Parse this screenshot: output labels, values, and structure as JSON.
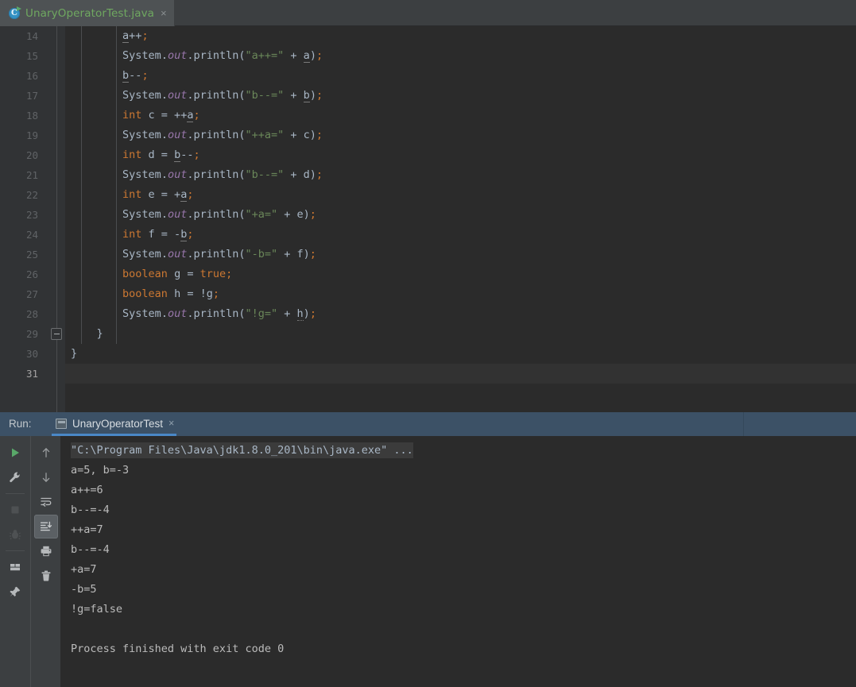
{
  "editor": {
    "tab": {
      "filename": "UnaryOperatorTest.java",
      "icon": "java-class-runnable-icon",
      "icon_letter": "C",
      "close_label": "×",
      "label_color": "#6fa860"
    },
    "first_line_number": 14,
    "current_line_number": 31,
    "lines": [
      {
        "n": 14,
        "tokens": [
          {
            "t": "        ",
            "c": "plain"
          },
          {
            "t": "a",
            "c": "var"
          },
          {
            "t": "++",
            "c": "plain"
          },
          {
            "t": ";",
            "c": "semi"
          }
        ]
      },
      {
        "n": 15,
        "tokens": [
          {
            "t": "        ",
            "c": "plain"
          },
          {
            "t": "System",
            "c": "plain"
          },
          {
            "t": ".",
            "c": "plain"
          },
          {
            "t": "out",
            "c": "field"
          },
          {
            "t": ".println(",
            "c": "plain"
          },
          {
            "t": "\"a++=\"",
            "c": "str"
          },
          {
            "t": " + ",
            "c": "plain"
          },
          {
            "t": "a",
            "c": "var"
          },
          {
            "t": ")",
            "c": "plain"
          },
          {
            "t": ";",
            "c": "semi"
          }
        ]
      },
      {
        "n": 16,
        "tokens": [
          {
            "t": "        ",
            "c": "plain"
          },
          {
            "t": "b",
            "c": "var"
          },
          {
            "t": "--",
            "c": "plain"
          },
          {
            "t": ";",
            "c": "semi"
          }
        ]
      },
      {
        "n": 17,
        "tokens": [
          {
            "t": "        ",
            "c": "plain"
          },
          {
            "t": "System",
            "c": "plain"
          },
          {
            "t": ".",
            "c": "plain"
          },
          {
            "t": "out",
            "c": "field"
          },
          {
            "t": ".println(",
            "c": "plain"
          },
          {
            "t": "\"b--=\"",
            "c": "str"
          },
          {
            "t": " + ",
            "c": "plain"
          },
          {
            "t": "b",
            "c": "var"
          },
          {
            "t": ")",
            "c": "plain"
          },
          {
            "t": ";",
            "c": "semi"
          }
        ]
      },
      {
        "n": 18,
        "tokens": [
          {
            "t": "        ",
            "c": "plain"
          },
          {
            "t": "int",
            "c": "kw"
          },
          {
            "t": " c = ++",
            "c": "plain"
          },
          {
            "t": "a",
            "c": "var"
          },
          {
            "t": ";",
            "c": "semi"
          }
        ]
      },
      {
        "n": 19,
        "tokens": [
          {
            "t": "        ",
            "c": "plain"
          },
          {
            "t": "System",
            "c": "plain"
          },
          {
            "t": ".",
            "c": "plain"
          },
          {
            "t": "out",
            "c": "field"
          },
          {
            "t": ".println(",
            "c": "plain"
          },
          {
            "t": "\"++a=\"",
            "c": "str"
          },
          {
            "t": " + c)",
            "c": "plain"
          },
          {
            "t": ";",
            "c": "semi"
          }
        ]
      },
      {
        "n": 20,
        "tokens": [
          {
            "t": "        ",
            "c": "plain"
          },
          {
            "t": "int",
            "c": "kw"
          },
          {
            "t": " d = ",
            "c": "plain"
          },
          {
            "t": "b",
            "c": "var"
          },
          {
            "t": "--",
            "c": "plain"
          },
          {
            "t": ";",
            "c": "semi"
          }
        ]
      },
      {
        "n": 21,
        "tokens": [
          {
            "t": "        ",
            "c": "plain"
          },
          {
            "t": "System",
            "c": "plain"
          },
          {
            "t": ".",
            "c": "plain"
          },
          {
            "t": "out",
            "c": "field"
          },
          {
            "t": ".println(",
            "c": "plain"
          },
          {
            "t": "\"b--=\"",
            "c": "str"
          },
          {
            "t": " + d)",
            "c": "plain"
          },
          {
            "t": ";",
            "c": "semi"
          }
        ]
      },
      {
        "n": 22,
        "tokens": [
          {
            "t": "        ",
            "c": "plain"
          },
          {
            "t": "int",
            "c": "kw"
          },
          {
            "t": " e = +",
            "c": "plain"
          },
          {
            "t": "a",
            "c": "var"
          },
          {
            "t": ";",
            "c": "semi"
          }
        ]
      },
      {
        "n": 23,
        "tokens": [
          {
            "t": "        ",
            "c": "plain"
          },
          {
            "t": "System",
            "c": "plain"
          },
          {
            "t": ".",
            "c": "plain"
          },
          {
            "t": "out",
            "c": "field"
          },
          {
            "t": ".println(",
            "c": "plain"
          },
          {
            "t": "\"+a=\"",
            "c": "str"
          },
          {
            "t": " + e)",
            "c": "plain"
          },
          {
            "t": ";",
            "c": "semi"
          }
        ]
      },
      {
        "n": 24,
        "tokens": [
          {
            "t": "        ",
            "c": "plain"
          },
          {
            "t": "int",
            "c": "kw"
          },
          {
            "t": " f = -",
            "c": "plain"
          },
          {
            "t": "b",
            "c": "var"
          },
          {
            "t": ";",
            "c": "semi"
          }
        ]
      },
      {
        "n": 25,
        "tokens": [
          {
            "t": "        ",
            "c": "plain"
          },
          {
            "t": "System",
            "c": "plain"
          },
          {
            "t": ".",
            "c": "plain"
          },
          {
            "t": "out",
            "c": "field"
          },
          {
            "t": ".println(",
            "c": "plain"
          },
          {
            "t": "\"-b=\"",
            "c": "str"
          },
          {
            "t": " + f)",
            "c": "plain"
          },
          {
            "t": ";",
            "c": "semi"
          }
        ]
      },
      {
        "n": 26,
        "tokens": [
          {
            "t": "        ",
            "c": "plain"
          },
          {
            "t": "boolean",
            "c": "kw"
          },
          {
            "t": " g = ",
            "c": "plain"
          },
          {
            "t": "true",
            "c": "kw"
          },
          {
            "t": ";",
            "c": "semi"
          }
        ]
      },
      {
        "n": 27,
        "tokens": [
          {
            "t": "        ",
            "c": "plain"
          },
          {
            "t": "boolean",
            "c": "kw"
          },
          {
            "t": " h = !g",
            "c": "plain"
          },
          {
            "t": ";",
            "c": "semi"
          }
        ]
      },
      {
        "n": 28,
        "tokens": [
          {
            "t": "        ",
            "c": "plain"
          },
          {
            "t": "System",
            "c": "plain"
          },
          {
            "t": ".",
            "c": "plain"
          },
          {
            "t": "out",
            "c": "field"
          },
          {
            "t": ".println(",
            "c": "plain"
          },
          {
            "t": "\"!g=\"",
            "c": "str"
          },
          {
            "t": " + ",
            "c": "plain"
          },
          {
            "t": "h",
            "c": "var-sq"
          },
          {
            "t": ")",
            "c": "plain"
          },
          {
            "t": ";",
            "c": "semi"
          }
        ]
      },
      {
        "n": 29,
        "tokens": [
          {
            "t": "    }",
            "c": "plain"
          }
        ]
      },
      {
        "n": 30,
        "tokens": [
          {
            "t": "}",
            "c": "plain"
          }
        ]
      },
      {
        "n": 31,
        "tokens": [
          {
            "t": "",
            "c": "plain"
          }
        ]
      }
    ]
  },
  "run_panel": {
    "label": "Run:",
    "tab": {
      "title": "UnaryOperatorTest",
      "icon": "console-window-icon",
      "close_label": "×",
      "active_underline_color": "#4a88c7"
    },
    "toolbar_left": [
      {
        "name": "rerun-button",
        "icon": "green-play-icon",
        "enabled": true,
        "tooltip": "Rerun"
      },
      {
        "name": "edit-configuration-button",
        "icon": "wrench-icon",
        "enabled": true,
        "tooltip": "Edit Configuration"
      },
      {
        "name": "stop-button",
        "icon": "stop-square-icon",
        "enabled": false,
        "tooltip": "Stop"
      },
      {
        "name": "debug-button",
        "icon": "bug-icon",
        "enabled": false,
        "tooltip": "Debug"
      },
      {
        "name": "layout-settings-button",
        "icon": "layout-grid-icon",
        "enabled": true,
        "tooltip": "Layout Settings"
      },
      {
        "name": "pin-tab-button",
        "icon": "pin-icon",
        "enabled": true,
        "tooltip": "Pin Tab"
      }
    ],
    "toolbar_right": [
      {
        "name": "up-the-stack-trace-button",
        "icon": "arrow-up-icon",
        "enabled": true,
        "active": false,
        "tooltip": "Up the Stack Trace"
      },
      {
        "name": "down-the-stack-trace-button",
        "icon": "arrow-down-icon",
        "enabled": true,
        "active": false,
        "tooltip": "Down the Stack Trace"
      },
      {
        "name": "soft-wrap-button",
        "icon": "soft-wrap-icon",
        "enabled": true,
        "active": false,
        "tooltip": "Use Soft Wraps"
      },
      {
        "name": "scroll-to-end-button",
        "icon": "scroll-to-end-icon",
        "enabled": true,
        "active": true,
        "tooltip": "Scroll to the End"
      },
      {
        "name": "print-button",
        "icon": "printer-icon",
        "enabled": true,
        "active": false,
        "tooltip": "Print"
      },
      {
        "name": "clear-all-button",
        "icon": "trash-icon",
        "enabled": true,
        "active": false,
        "tooltip": "Clear All"
      }
    ],
    "console": [
      {
        "text": "\"C:\\Program Files\\Java\\jdk1.8.0_201\\bin\\java.exe\" ...",
        "highlight": true
      },
      {
        "text": "a=5, b=-3",
        "highlight": false
      },
      {
        "text": "a++=6",
        "highlight": false
      },
      {
        "text": "b--=-4",
        "highlight": false
      },
      {
        "text": "++a=7",
        "highlight": false
      },
      {
        "text": "b--=-4",
        "highlight": false
      },
      {
        "text": "+a=7",
        "highlight": false
      },
      {
        "text": "-b=5",
        "highlight": false
      },
      {
        "text": "!g=false",
        "highlight": false
      },
      {
        "text": "",
        "highlight": false
      },
      {
        "text": "Process finished with exit code 0",
        "highlight": false
      }
    ]
  },
  "theme": {
    "editor_bg": "#2b2b2b",
    "gutter_bg": "#313335",
    "panel_bg": "#3c3f41",
    "tab_active_bg": "#4e5254",
    "run_header_bg": "#3c5166",
    "keyword": "#cc7832",
    "string": "#6a8759",
    "field_italic": "#9876aa",
    "plain_text": "#a9b7c6",
    "console_text": "#bbbbbb",
    "accent_blue": "#4a88c7",
    "run_green": "#59a869"
  }
}
